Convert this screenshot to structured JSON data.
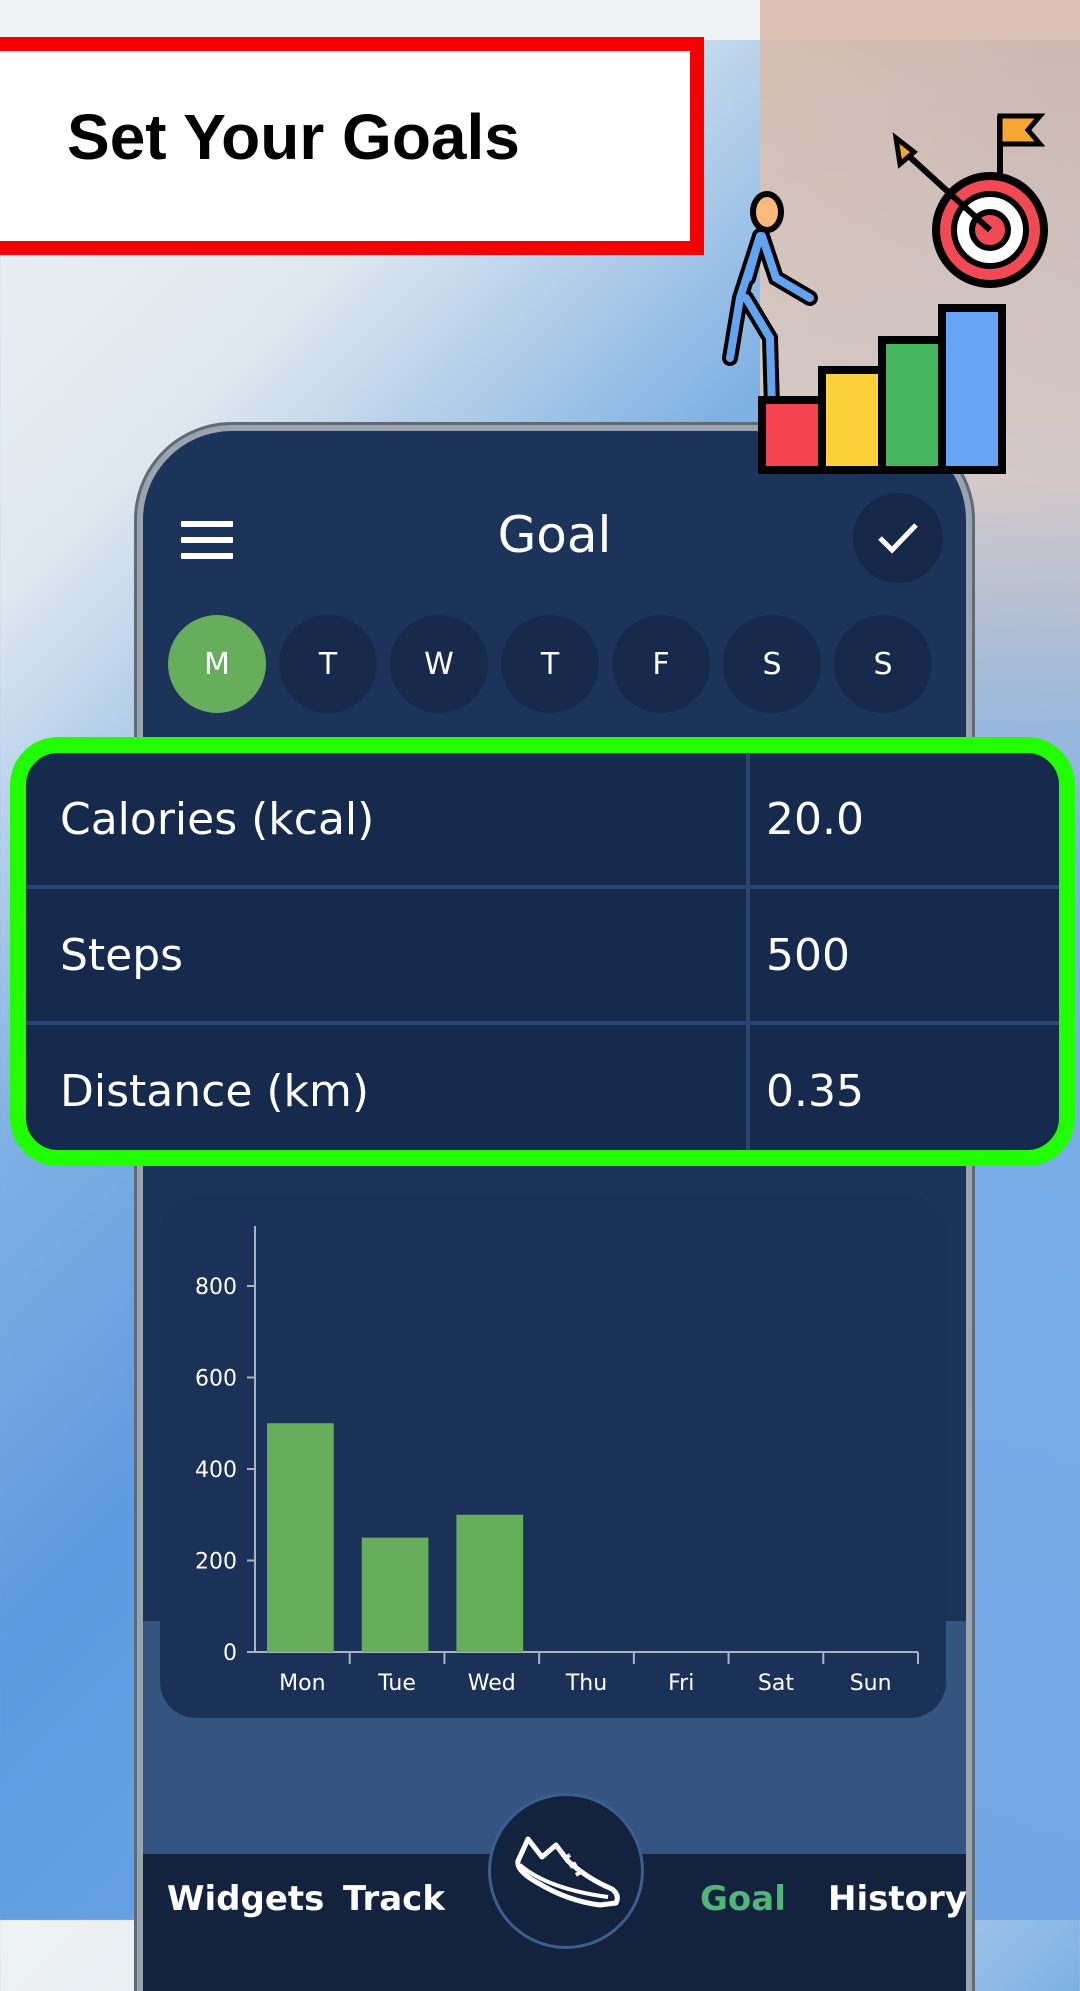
{
  "banner": {
    "title": "Set Your Goals"
  },
  "header": {
    "title": "Goal",
    "menu_icon": "hamburger-icon",
    "confirm_icon": "check-icon"
  },
  "days": [
    {
      "label": "M",
      "active": true
    },
    {
      "label": "T",
      "active": false
    },
    {
      "label": "W",
      "active": false
    },
    {
      "label": "T",
      "active": false
    },
    {
      "label": "F",
      "active": false
    },
    {
      "label": "S",
      "active": false
    },
    {
      "label": "S",
      "active": false
    }
  ],
  "goals": [
    {
      "label": "Calories (kcal)",
      "value": "20.0"
    },
    {
      "label": "Steps",
      "value": "500"
    },
    {
      "label": "Distance (km)",
      "value": "0.35"
    }
  ],
  "nav": {
    "items": [
      {
        "label": "Widgets",
        "active": false
      },
      {
        "label": "Track",
        "active": false
      },
      {
        "label": "Goal",
        "active": true
      },
      {
        "label": "History",
        "active": false
      }
    ],
    "center_icon": "shoe-icon"
  },
  "colors": {
    "accent_green": "#66ad5c",
    "nav_active": "#4fb578",
    "highlight_green": "#22fe02",
    "highlight_red": "#f40101"
  },
  "chart_data": {
    "type": "bar",
    "categories": [
      "Mon",
      "Tue",
      "Wed",
      "Thu",
      "Fri",
      "Sat",
      "Sun"
    ],
    "values": [
      500,
      250,
      300,
      0,
      0,
      0,
      0
    ],
    "yticks": [
      0,
      200,
      400,
      600,
      800
    ],
    "ylim": [
      0,
      950
    ],
    "title": "",
    "xlabel": "",
    "ylabel": "",
    "grid": false,
    "bar_color": "#66ad5c"
  }
}
